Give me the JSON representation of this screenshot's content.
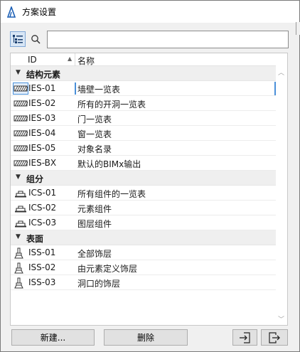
{
  "window": {
    "title": "方案设置"
  },
  "toolbar": {
    "search_value": "",
    "search_placeholder": ""
  },
  "columns": {
    "id": "ID",
    "name": "名称"
  },
  "groups": [
    {
      "label": "结构元素",
      "icon": "hatch-icon",
      "items": [
        {
          "id": "IES-01",
          "name": "墙壁一览表",
          "selected": true
        },
        {
          "id": "IES-02",
          "name": "所有的开洞一览表"
        },
        {
          "id": "IES-03",
          "name": "门一览表"
        },
        {
          "id": "IES-04",
          "name": "窗一览表"
        },
        {
          "id": "IES-05",
          "name": "对象名录"
        },
        {
          "id": "IES-BX",
          "name": "默认的BIMx输出"
        }
      ]
    },
    {
      "label": "组分",
      "icon": "components-icon",
      "items": [
        {
          "id": "ICS-01",
          "name": "所有组件的一览表"
        },
        {
          "id": "ICS-02",
          "name": "元素组件"
        },
        {
          "id": "ICS-03",
          "name": "图层组件"
        }
      ]
    },
    {
      "label": "表面",
      "icon": "paint-brush-icon",
      "items": [
        {
          "id": "ISS-01",
          "name": "全部饰层"
        },
        {
          "id": "ISS-02",
          "name": "由元素定义饰层"
        },
        {
          "id": "ISS-03",
          "name": "洞口的饰层"
        }
      ]
    }
  ],
  "buttons": {
    "new": "新建...",
    "delete": "删除"
  },
  "colors": {
    "accent": "#4a90d9",
    "group_bg": "#efefef"
  }
}
